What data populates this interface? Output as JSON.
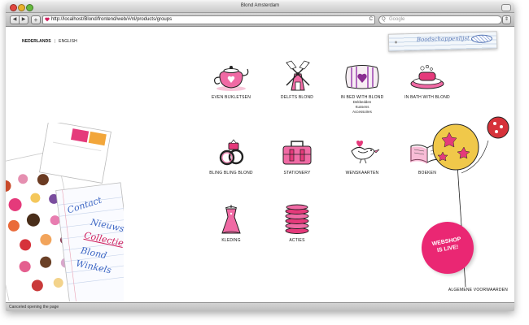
{
  "window": {
    "title": "Blond Amsterdam"
  },
  "browser": {
    "back_label": "◀",
    "forward_label": "▶",
    "add_label": "+",
    "url": "http://localhost/Blond/frontend/web/#/nl/products/groups",
    "reload_label": "C",
    "search_placeholder": "Google",
    "bookmark_label": "⇕"
  },
  "lang": {
    "active": "NEDERLANDS",
    "separator": "|",
    "other": "ENGLISH"
  },
  "basket": {
    "label": "Boodschappenlijst"
  },
  "categories": [
    {
      "label": "EVEN BIJKLETSEN",
      "icon": "teapot-icon"
    },
    {
      "label": "DELFTS BLOND",
      "icon": "windmill-icon"
    },
    {
      "label": "IN BED WITH BLOND",
      "icon": "pillow-icon",
      "sub": [
        "Dekbedden",
        "Kussens",
        "Accessoires"
      ]
    },
    {
      "label": "IN BATH WITH BLOND",
      "icon": "soap-icon"
    },
    {
      "label": "BLING BLING BLOND",
      "icon": "rings-icon"
    },
    {
      "label": "STATIONERY",
      "icon": "suitcase-icon"
    },
    {
      "label": "WENSKAARTEN",
      "icon": "bird-icon"
    },
    {
      "label": "BOEKEN",
      "icon": "book-icon"
    },
    {
      "label": "KLEDING",
      "icon": "dress-icon"
    },
    {
      "label": "ACTIES",
      "icon": "cookie-stack-icon"
    }
  ],
  "nav_cards": {
    "contact": "Contact",
    "items": [
      "Nieuws",
      "Collectie",
      "Blond",
      "Winkels"
    ]
  },
  "webshop": {
    "line1": "WEBSHOP",
    "line2": "IS LIVE!"
  },
  "footer": {
    "terms": "ALGEMENE VOORWAARDEN"
  },
  "status": {
    "text": "Canceled opening the page"
  },
  "colors": {
    "pink": "#ea2773",
    "blue": "#3c66c4"
  }
}
